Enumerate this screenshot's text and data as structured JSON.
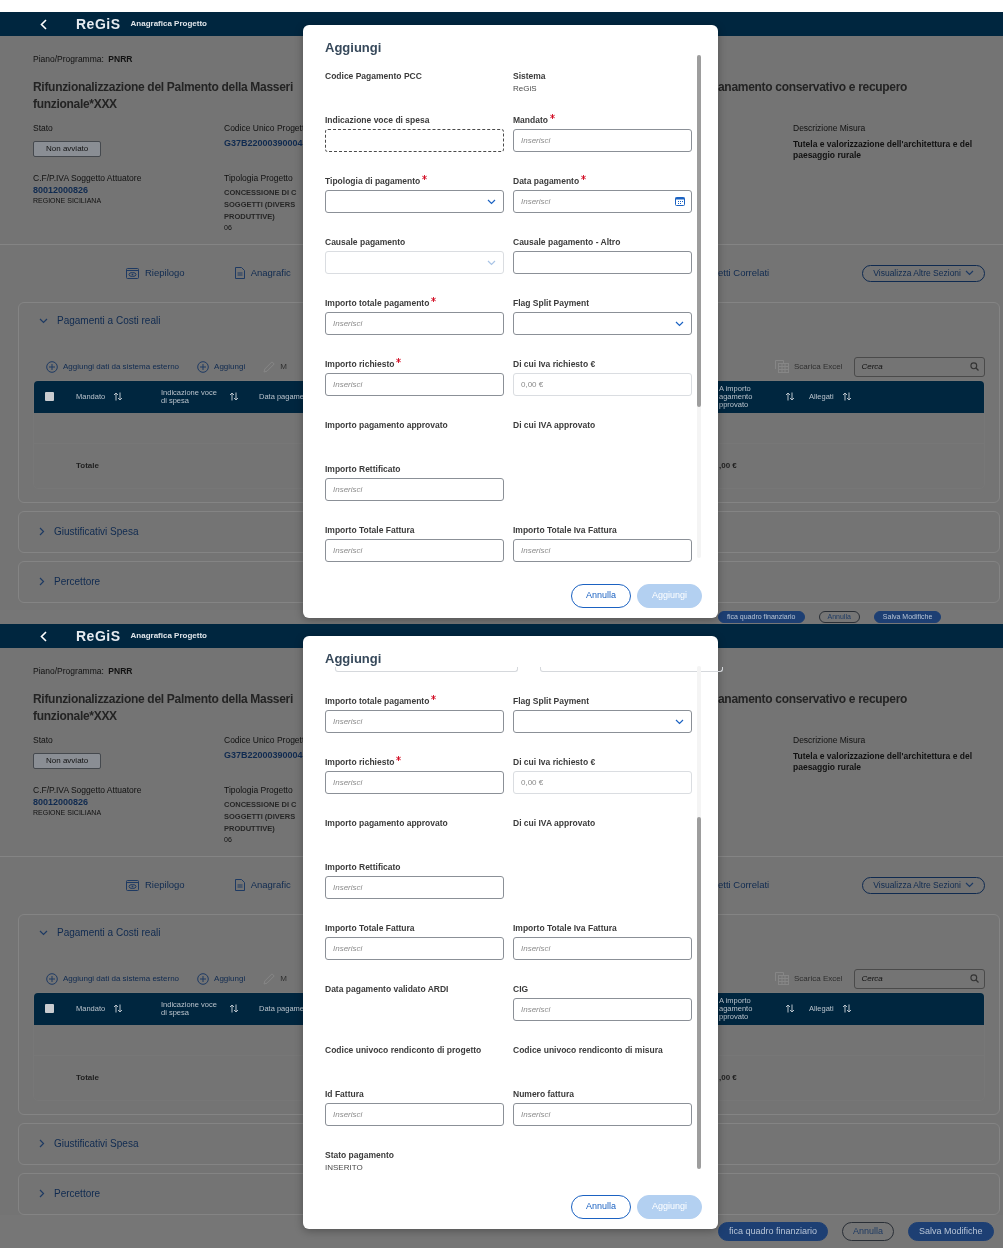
{
  "panels": [
    {
      "app_bar": {
        "logo": "ReGiS",
        "title": "Anagrafica Progetto"
      },
      "program": {
        "label": "Piano/Programma:",
        "value": "PNRR"
      },
      "title": {
        "line_1_left": "Rifunzionalizzazione del Palmento della Masseri",
        "line_1_right": "anamento conservativo e recupero",
        "line_2": "funzionale*XXX"
      },
      "status": {
        "label": "Stato",
        "value": "Non avviato"
      },
      "cup": {
        "label": "Codice Unico Progett",
        "value": "G37B22000390004"
      },
      "measure": {
        "label": "Descrizione Misura",
        "value": "Tutela e valorizzazione dell'architettura e del paesaggio rurale"
      },
      "implementer": {
        "label": "C.F/P.IVA Soggetto Attuatore",
        "value": "80012000826",
        "sub": "REGIONE SICILIANA"
      },
      "project_type": {
        "label": "Tipologia Progetto",
        "value": "CONCESSIONE DI C\nSOGGETTI (DIVERS\nPRODUTTIVE)",
        "code": "06"
      },
      "nav": {
        "left": [
          {
            "label": "Riepilogo"
          },
          {
            "label": "Anagrafic"
          }
        ],
        "right": [
          {
            "label": "etti Correlati"
          }
        ],
        "more": "Visualizza Altre Sezioni"
      },
      "sections": [
        {
          "title": "Pagamenti a Costi reali",
          "expanded": true,
          "toolbar": [
            {
              "kind": "add",
              "label": "Aggiungi dati da sistema esterno",
              "disabled": false
            },
            {
              "kind": "add",
              "label": "Aggiungi",
              "disabled": false
            },
            {
              "kind": "edit",
              "label": "M",
              "disabled": true
            }
          ],
          "export": {
            "label": "Scarica Excel",
            "disabled": true
          },
          "search": {
            "placeholder": "Cerca"
          },
          "select_all": {
            "checked": false
          },
          "columns_left": [
            {
              "label": "Mandato",
              "sortable": true
            },
            {
              "label": "Indicazione voce di spesa",
              "sortable": true
            },
            {
              "label": "Data pagame",
              "sortable": false
            }
          ],
          "columns_right": [
            {
              "label": "A importo agamento pprovato",
              "sortable": true
            },
            {
              "label": "Allegati",
              "sortable": true
            }
          ],
          "total_label": "Totale",
          "total_value": ",00 €"
        },
        {
          "title": "Giustificativi Spesa",
          "expanded": false
        },
        {
          "title": "Percettore",
          "expanded": false
        }
      ],
      "footer": [
        {
          "kind": "primary",
          "label": "fica quadro finanziario"
        },
        {
          "kind": "outline",
          "label": "Annulla"
        },
        {
          "kind": "primary",
          "label": "Salva Modifiche"
        }
      ],
      "dialog": {
        "title": "Aggiungi",
        "scrolled_to_bottom": false,
        "rows": [
          [
            {
              "kind": "info",
              "label": "Codice Pagamento PCC",
              "required": false
            },
            {
              "kind": "info",
              "label": "Sistema",
              "required": false,
              "value": "ReGiS"
            }
          ],
          [
            {
              "kind": "text",
              "label": "Indicazione voce di spesa",
              "required": false,
              "disabled": false,
              "focused": true
            },
            {
              "kind": "text",
              "label": "Mandato",
              "required": true,
              "placeholder": "Inserisci",
              "disabled": false,
              "focused": false
            }
          ],
          [
            {
              "kind": "select",
              "label": "Tipologia di pagamento",
              "required": true,
              "disabled": false,
              "focused": false
            },
            {
              "kind": "date",
              "label": "Data pagamento",
              "required": true,
              "placeholder": "Inserisci",
              "disabled": false,
              "focused": false
            }
          ],
          [
            {
              "kind": "select",
              "label": "Causale pagamento",
              "required": false,
              "disabled": true,
              "focused": false
            },
            {
              "kind": "text",
              "label": "Causale pagamento - Altro",
              "required": false,
              "disabled": false,
              "focused": false
            }
          ],
          [
            {
              "kind": "text",
              "label": "Importo totale pagamento",
              "required": true,
              "placeholder": "Inserisci",
              "disabled": false,
              "focused": false
            },
            {
              "kind": "select",
              "label": "Flag Split Payment",
              "required": false,
              "disabled": false,
              "focused": false
            }
          ],
          [
            {
              "kind": "text",
              "label": "Importo richiesto",
              "required": true,
              "placeholder": "Inserisci",
              "disabled": false,
              "focused": false
            },
            {
              "kind": "text",
              "label": "Di cui Iva richiesto €",
              "required": false,
              "value": "0,00 €",
              "disabled": true,
              "focused": false
            }
          ],
          [
            {
              "kind": "info",
              "label": "Importo pagamento approvato",
              "required": false
            },
            {
              "kind": "info",
              "label": "Di cui IVA approvato",
              "required": false
            }
          ],
          [
            {
              "kind": "text",
              "label": "Importo Rettificato",
              "required": false,
              "placeholder": "Inserisci",
              "disabled": false,
              "focused": false
            }
          ],
          [
            {
              "kind": "text",
              "label": "Importo Totale Fattura",
              "required": false,
              "placeholder": "Inserisci",
              "disabled": false,
              "focused": false
            },
            {
              "kind": "text",
              "label": "Importo Totale Iva Fattura",
              "required": false,
              "placeholder": "Inserisci",
              "disabled": false,
              "focused": false
            }
          ]
        ],
        "buttons": [
          {
            "kind": "outline",
            "label": "Annulla",
            "disabled": false
          },
          {
            "kind": "primary",
            "label": "Aggiungi",
            "disabled": true
          }
        ]
      }
    },
    {
      "app_bar": {
        "logo": "ReGiS",
        "title": "Anagrafica Progetto"
      },
      "program": {
        "label": "Piano/Programma:",
        "value": "PNRR"
      },
      "title": {
        "line_1_left": "Rifunzionalizzazione del Palmento della Masseri",
        "line_1_right": "anamento conservativo e recupero",
        "line_2": "funzionale*XXX"
      },
      "status": {
        "label": "Stato",
        "value": "Non avviato"
      },
      "cup": {
        "label": "Codice Unico Progett",
        "value": "G37B22000390004"
      },
      "measure": {
        "label": "Descrizione Misura",
        "value": "Tutela e valorizzazione dell'architettura e del paesaggio rurale"
      },
      "implementer": {
        "label": "C.F/P.IVA Soggetto Attuatore",
        "value": "80012000826",
        "sub": "REGIONE SICILIANA"
      },
      "project_type": {
        "label": "Tipologia Progetto",
        "value": "CONCESSIONE DI C\nSOGGETTI (DIVERS\nPRODUTTIVE)",
        "code": "06"
      },
      "nav": {
        "left": [
          {
            "label": "Riepilogo"
          },
          {
            "label": "Anagrafic"
          }
        ],
        "right": [
          {
            "label": "etti Correlati"
          }
        ],
        "more": "Visualizza Altre Sezioni"
      },
      "sections": [
        {
          "title": "Pagamenti a Costi reali",
          "expanded": true,
          "toolbar": [
            {
              "kind": "add",
              "label": "Aggiungi dati da sistema esterno",
              "disabled": false
            },
            {
              "kind": "add",
              "label": "Aggiungi",
              "disabled": false
            },
            {
              "kind": "edit",
              "label": "M",
              "disabled": true
            }
          ],
          "export": {
            "label": "Scarica Excel",
            "disabled": true
          },
          "search": {
            "placeholder": "Cerca"
          },
          "select_all": {
            "checked": false
          },
          "columns_left": [
            {
              "label": "Mandato",
              "sortable": true
            },
            {
              "label": "Indicazione voce di spesa",
              "sortable": true
            },
            {
              "label": "Data pagame",
              "sortable": false
            }
          ],
          "columns_right": [
            {
              "label": "A importo agamento pprovato",
              "sortable": true
            },
            {
              "label": "Allegati",
              "sortable": true
            }
          ],
          "total_label": "Totale",
          "total_value": ",00 €"
        },
        {
          "title": "Giustificativi Spesa",
          "expanded": false
        },
        {
          "title": "Percettore",
          "expanded": false
        }
      ],
      "footer": [
        {
          "kind": "primary",
          "label": "fica quadro finanziario"
        },
        {
          "kind": "outline",
          "label": "Annulla"
        },
        {
          "kind": "primary",
          "label": "Salva Modifiche"
        }
      ],
      "dialog": {
        "title": "Aggiungi",
        "scrolled_to_bottom": true,
        "clipped_above": true,
        "rows": [
          [
            {
              "kind": "text",
              "label": "Importo totale pagamento",
              "required": true,
              "placeholder": "Inserisci",
              "disabled": false,
              "focused": false
            },
            {
              "kind": "select",
              "label": "Flag Split Payment",
              "required": false,
              "disabled": false,
              "focused": false
            }
          ],
          [
            {
              "kind": "text",
              "label": "Importo richiesto",
              "required": true,
              "placeholder": "Inserisci",
              "disabled": false,
              "focused": false
            },
            {
              "kind": "text",
              "label": "Di cui Iva richiesto €",
              "required": false,
              "value": "0,00 €",
              "disabled": true,
              "focused": false
            }
          ],
          [
            {
              "kind": "info",
              "label": "Importo pagamento approvato",
              "required": false
            },
            {
              "kind": "info",
              "label": "Di cui IVA approvato",
              "required": false
            }
          ],
          [
            {
              "kind": "text",
              "label": "Importo Rettificato",
              "required": false,
              "placeholder": "Inserisci",
              "disabled": false,
              "focused": false
            }
          ],
          [
            {
              "kind": "text",
              "label": "Importo Totale Fattura",
              "required": false,
              "placeholder": "Inserisci",
              "disabled": false,
              "focused": false
            },
            {
              "kind": "text",
              "label": "Importo Totale Iva Fattura",
              "required": false,
              "placeholder": "Inserisci",
              "disabled": false,
              "focused": false
            }
          ],
          [
            {
              "kind": "info",
              "label": "Data pagamento validato ARDI",
              "required": false
            },
            {
              "kind": "text",
              "label": "CIG",
              "required": false,
              "placeholder": "Inserisci",
              "disabled": false,
              "focused": false
            }
          ],
          [
            {
              "kind": "info",
              "label": "Codice univoco rendiconto di progetto",
              "required": false
            },
            {
              "kind": "info",
              "label": "Codice univoco rendiconto di misura",
              "required": false
            }
          ],
          [
            {
              "kind": "text",
              "label": "Id Fattura",
              "required": false,
              "placeholder": "Inserisci",
              "disabled": false,
              "focused": false
            },
            {
              "kind": "text",
              "label": "Numero fattura",
              "required": false,
              "placeholder": "Inserisci",
              "disabled": false,
              "focused": false
            }
          ],
          [
            {
              "kind": "info",
              "label": "Stato pagamento",
              "required": false,
              "value": "INSERITO"
            }
          ]
        ],
        "buttons": [
          {
            "kind": "outline",
            "label": "Annulla",
            "disabled": false
          },
          {
            "kind": "primary",
            "label": "Aggiungi",
            "disabled": true
          }
        ]
      }
    }
  ]
}
